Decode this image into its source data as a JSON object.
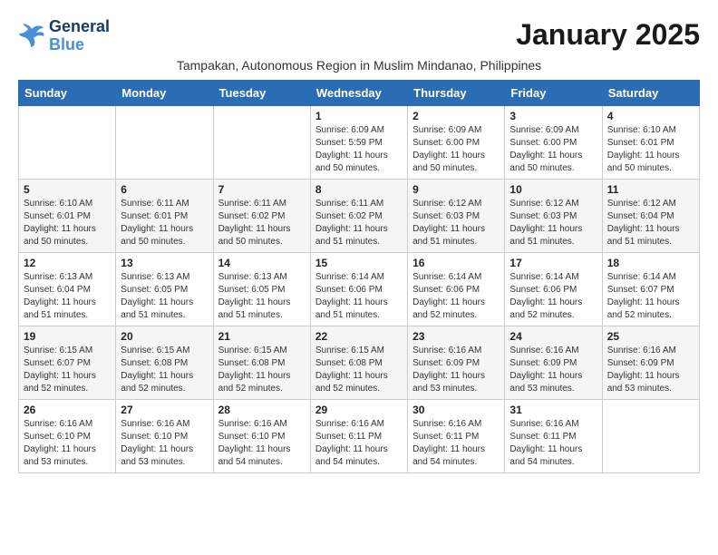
{
  "logo": {
    "line1": "General",
    "line2": "Blue"
  },
  "title": "January 2025",
  "subtitle": "Tampakan, Autonomous Region in Muslim Mindanao, Philippines",
  "weekdays": [
    "Sunday",
    "Monday",
    "Tuesday",
    "Wednesday",
    "Thursday",
    "Friday",
    "Saturday"
  ],
  "weeks": [
    [
      {
        "day": "",
        "sunrise": "",
        "sunset": "",
        "daylight": ""
      },
      {
        "day": "",
        "sunrise": "",
        "sunset": "",
        "daylight": ""
      },
      {
        "day": "",
        "sunrise": "",
        "sunset": "",
        "daylight": ""
      },
      {
        "day": "1",
        "sunrise": "Sunrise: 6:09 AM",
        "sunset": "Sunset: 5:59 PM",
        "daylight": "Daylight: 11 hours and 50 minutes."
      },
      {
        "day": "2",
        "sunrise": "Sunrise: 6:09 AM",
        "sunset": "Sunset: 6:00 PM",
        "daylight": "Daylight: 11 hours and 50 minutes."
      },
      {
        "day": "3",
        "sunrise": "Sunrise: 6:09 AM",
        "sunset": "Sunset: 6:00 PM",
        "daylight": "Daylight: 11 hours and 50 minutes."
      },
      {
        "day": "4",
        "sunrise": "Sunrise: 6:10 AM",
        "sunset": "Sunset: 6:01 PM",
        "daylight": "Daylight: 11 hours and 50 minutes."
      }
    ],
    [
      {
        "day": "5",
        "sunrise": "Sunrise: 6:10 AM",
        "sunset": "Sunset: 6:01 PM",
        "daylight": "Daylight: 11 hours and 50 minutes."
      },
      {
        "day": "6",
        "sunrise": "Sunrise: 6:11 AM",
        "sunset": "Sunset: 6:01 PM",
        "daylight": "Daylight: 11 hours and 50 minutes."
      },
      {
        "day": "7",
        "sunrise": "Sunrise: 6:11 AM",
        "sunset": "Sunset: 6:02 PM",
        "daylight": "Daylight: 11 hours and 50 minutes."
      },
      {
        "day": "8",
        "sunrise": "Sunrise: 6:11 AM",
        "sunset": "Sunset: 6:02 PM",
        "daylight": "Daylight: 11 hours and 51 minutes."
      },
      {
        "day": "9",
        "sunrise": "Sunrise: 6:12 AM",
        "sunset": "Sunset: 6:03 PM",
        "daylight": "Daylight: 11 hours and 51 minutes."
      },
      {
        "day": "10",
        "sunrise": "Sunrise: 6:12 AM",
        "sunset": "Sunset: 6:03 PM",
        "daylight": "Daylight: 11 hours and 51 minutes."
      },
      {
        "day": "11",
        "sunrise": "Sunrise: 6:12 AM",
        "sunset": "Sunset: 6:04 PM",
        "daylight": "Daylight: 11 hours and 51 minutes."
      }
    ],
    [
      {
        "day": "12",
        "sunrise": "Sunrise: 6:13 AM",
        "sunset": "Sunset: 6:04 PM",
        "daylight": "Daylight: 11 hours and 51 minutes."
      },
      {
        "day": "13",
        "sunrise": "Sunrise: 6:13 AM",
        "sunset": "Sunset: 6:05 PM",
        "daylight": "Daylight: 11 hours and 51 minutes."
      },
      {
        "day": "14",
        "sunrise": "Sunrise: 6:13 AM",
        "sunset": "Sunset: 6:05 PM",
        "daylight": "Daylight: 11 hours and 51 minutes."
      },
      {
        "day": "15",
        "sunrise": "Sunrise: 6:14 AM",
        "sunset": "Sunset: 6:06 PM",
        "daylight": "Daylight: 11 hours and 51 minutes."
      },
      {
        "day": "16",
        "sunrise": "Sunrise: 6:14 AM",
        "sunset": "Sunset: 6:06 PM",
        "daylight": "Daylight: 11 hours and 52 minutes."
      },
      {
        "day": "17",
        "sunrise": "Sunrise: 6:14 AM",
        "sunset": "Sunset: 6:06 PM",
        "daylight": "Daylight: 11 hours and 52 minutes."
      },
      {
        "day": "18",
        "sunrise": "Sunrise: 6:14 AM",
        "sunset": "Sunset: 6:07 PM",
        "daylight": "Daylight: 11 hours and 52 minutes."
      }
    ],
    [
      {
        "day": "19",
        "sunrise": "Sunrise: 6:15 AM",
        "sunset": "Sunset: 6:07 PM",
        "daylight": "Daylight: 11 hours and 52 minutes."
      },
      {
        "day": "20",
        "sunrise": "Sunrise: 6:15 AM",
        "sunset": "Sunset: 6:08 PM",
        "daylight": "Daylight: 11 hours and 52 minutes."
      },
      {
        "day": "21",
        "sunrise": "Sunrise: 6:15 AM",
        "sunset": "Sunset: 6:08 PM",
        "daylight": "Daylight: 11 hours and 52 minutes."
      },
      {
        "day": "22",
        "sunrise": "Sunrise: 6:15 AM",
        "sunset": "Sunset: 6:08 PM",
        "daylight": "Daylight: 11 hours and 52 minutes."
      },
      {
        "day": "23",
        "sunrise": "Sunrise: 6:16 AM",
        "sunset": "Sunset: 6:09 PM",
        "daylight": "Daylight: 11 hours and 53 minutes."
      },
      {
        "day": "24",
        "sunrise": "Sunrise: 6:16 AM",
        "sunset": "Sunset: 6:09 PM",
        "daylight": "Daylight: 11 hours and 53 minutes."
      },
      {
        "day": "25",
        "sunrise": "Sunrise: 6:16 AM",
        "sunset": "Sunset: 6:09 PM",
        "daylight": "Daylight: 11 hours and 53 minutes."
      }
    ],
    [
      {
        "day": "26",
        "sunrise": "Sunrise: 6:16 AM",
        "sunset": "Sunset: 6:10 PM",
        "daylight": "Daylight: 11 hours and 53 minutes."
      },
      {
        "day": "27",
        "sunrise": "Sunrise: 6:16 AM",
        "sunset": "Sunset: 6:10 PM",
        "daylight": "Daylight: 11 hours and 53 minutes."
      },
      {
        "day": "28",
        "sunrise": "Sunrise: 6:16 AM",
        "sunset": "Sunset: 6:10 PM",
        "daylight": "Daylight: 11 hours and 54 minutes."
      },
      {
        "day": "29",
        "sunrise": "Sunrise: 6:16 AM",
        "sunset": "Sunset: 6:11 PM",
        "daylight": "Daylight: 11 hours and 54 minutes."
      },
      {
        "day": "30",
        "sunrise": "Sunrise: 6:16 AM",
        "sunset": "Sunset: 6:11 PM",
        "daylight": "Daylight: 11 hours and 54 minutes."
      },
      {
        "day": "31",
        "sunrise": "Sunrise: 6:16 AM",
        "sunset": "Sunset: 6:11 PM",
        "daylight": "Daylight: 11 hours and 54 minutes."
      },
      {
        "day": "",
        "sunrise": "",
        "sunset": "",
        "daylight": ""
      }
    ]
  ]
}
